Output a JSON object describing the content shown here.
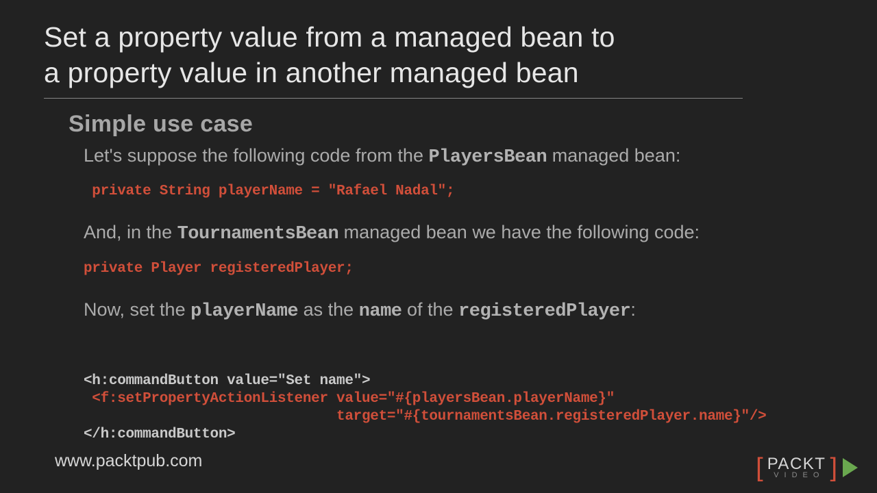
{
  "title_line1": "Set a property value from a managed bean to",
  "title_line2": "a property value in another managed bean",
  "subhead": "Simple use case",
  "p1_a": "Let's suppose the following code from the ",
  "p1_code": "PlayersBean",
  "p1_b": " managed bean:",
  "code1": " private String playerName = \"Rafael Nadal\";",
  "p2_a": "And, in the ",
  "p2_code": "TournamentsBean",
  "p2_b": " managed bean we have the following code:",
  "code2": "private Player registeredPlayer;",
  "p3_a": "Now, set the ",
  "p3_code1": "playerName",
  "p3_b": " as the ",
  "p3_code2": "name",
  "p3_c": " of the ",
  "p3_code3": "registeredPlayer",
  "p3_d": ":",
  "cb_l1": "<h:commandButton value=\"Set name\">",
  "cb_l2": " <f:setPropertyActionListener value=\"#{playersBean.playerName}\"",
  "cb_l3": "                              target=\"#{tournamentsBean.registeredPlayer.name}\"/>",
  "cb_l4": "</h:commandButton>",
  "footer_url": "www.packtpub.com",
  "logo_top": "PACKT",
  "logo_bot": "VIDEO"
}
